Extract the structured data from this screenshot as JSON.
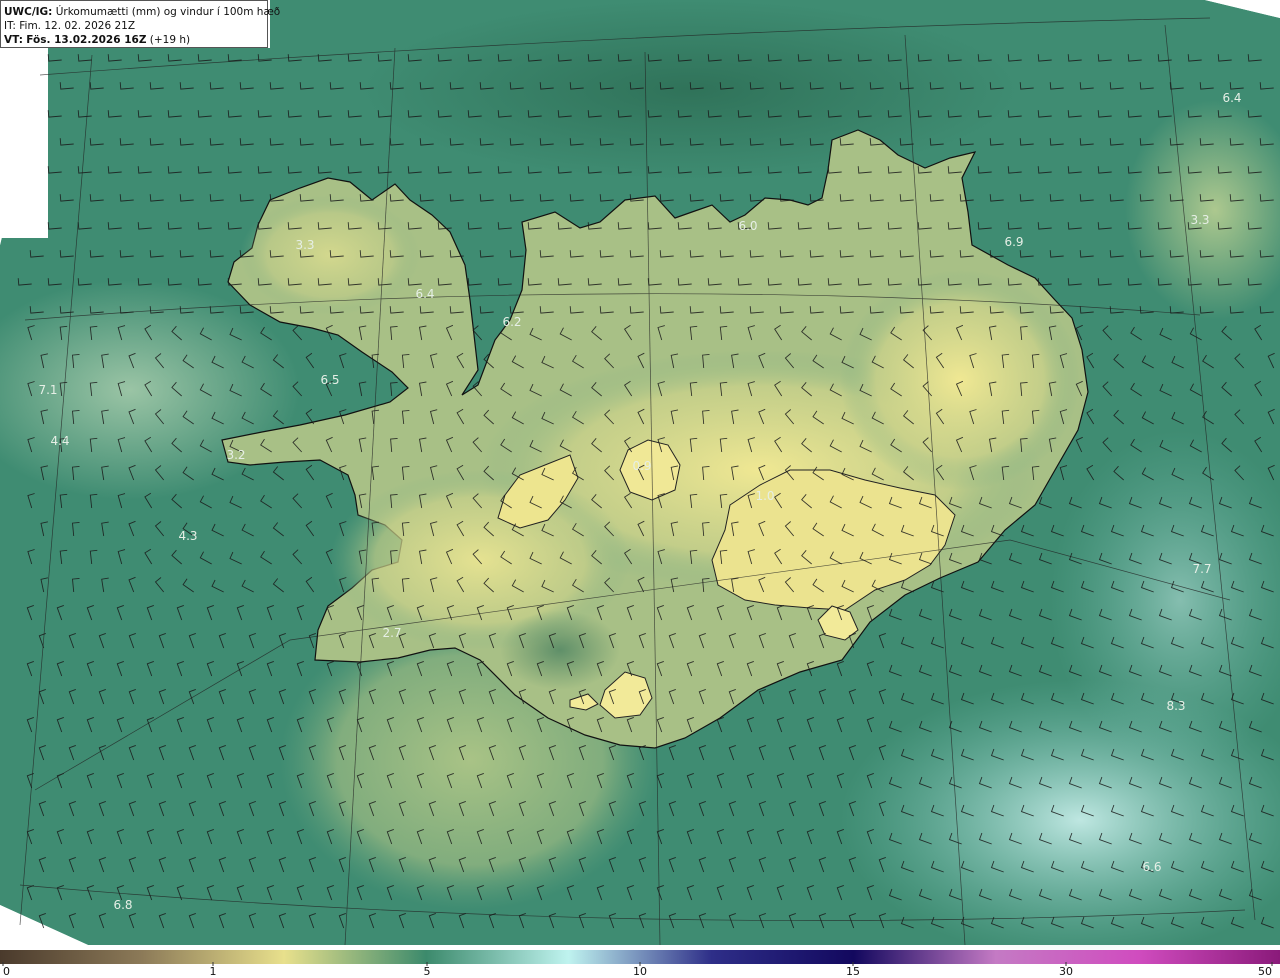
{
  "header": {
    "model": "UWC/IG:",
    "title": "Úrkomumætti (mm) og vindur í 100m hæð",
    "it_label": "IT:",
    "it_value": "Fim. 12. 02. 2026 21Z",
    "vt_label": "VT:",
    "vt_date": "Fös. 13.02.2026 16Z",
    "vt_offset": "(+19 h)"
  },
  "station_values": [
    {
      "text": "6.4"
    },
    {
      "text": "3.3"
    },
    {
      "text": "6.0"
    },
    {
      "text": "6.9"
    },
    {
      "text": "3.3"
    },
    {
      "text": "6.4"
    },
    {
      "text": "6.2"
    },
    {
      "text": "6.5"
    },
    {
      "text": "7.1"
    },
    {
      "text": "4.4"
    },
    {
      "text": "3.2"
    },
    {
      "text": "4.3"
    },
    {
      "text": "0.9"
    },
    {
      "text": "1.0"
    },
    {
      "text": "2.7"
    },
    {
      "text": "7.7"
    },
    {
      "text": "8.3"
    },
    {
      "text": "6.6"
    },
    {
      "text": "6.8"
    }
  ],
  "colorbar": {
    "ticks": [
      "0",
      "1",
      "5",
      "10",
      "15",
      "30",
      "50"
    ],
    "colors": [
      "#4a3a2c",
      "#8c7a58",
      "#e8e08c",
      "#3c8a6c",
      "#bff3ef",
      "#2e2e88",
      "#12085e",
      "#c47ac4",
      "#d04cbf",
      "#8a1a7a"
    ]
  },
  "colors": {
    "sea": "#3c8a70",
    "land_high": "#e9e392",
    "coast": "#111111"
  }
}
